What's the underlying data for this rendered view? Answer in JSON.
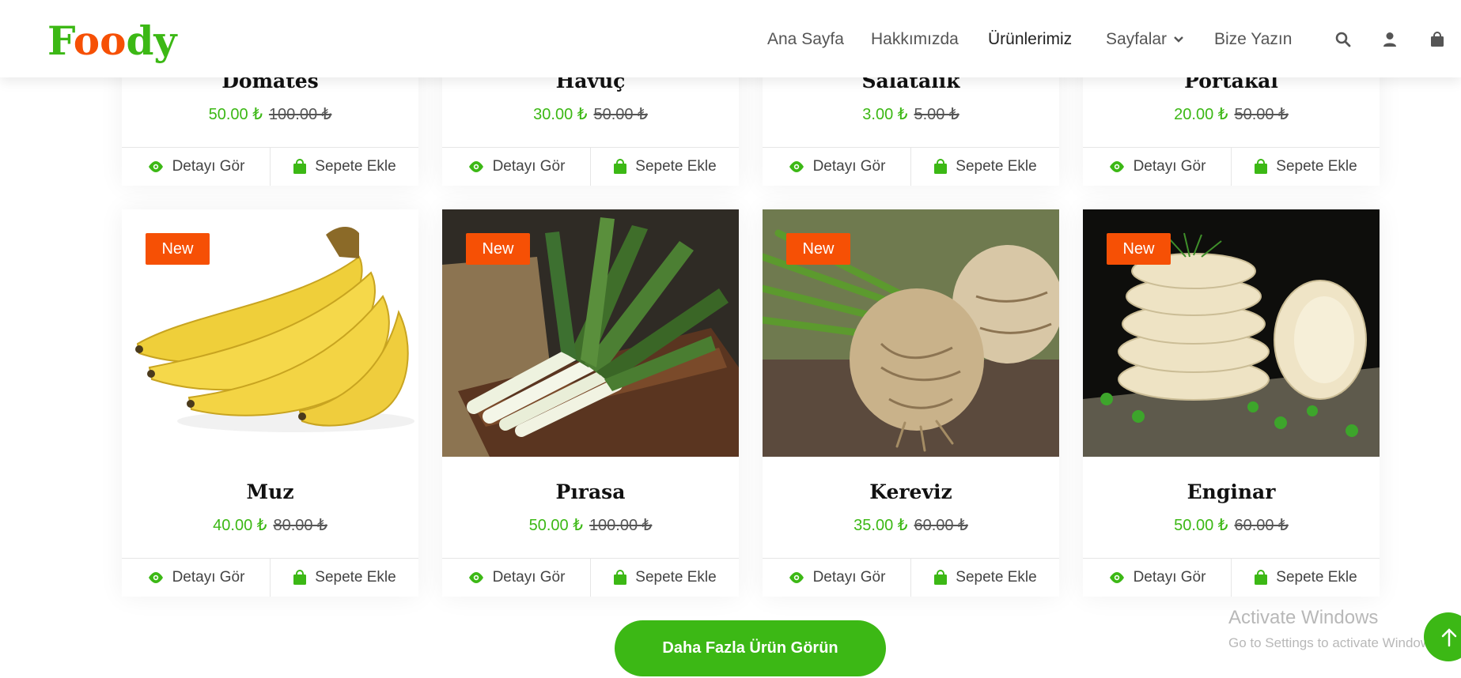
{
  "brand": {
    "part1": "F",
    "part2": "oo",
    "part3": "dy"
  },
  "nav": {
    "items": [
      "Ana Sayfa",
      "Hakkımızda",
      "Ürünlerimiz",
      "Sayfalar",
      "Bize Yazın"
    ],
    "active": "Ürünlerimiz",
    "icons": [
      "search-icon",
      "user-icon",
      "shopping-bag-icon"
    ]
  },
  "colors": {
    "green": "#3cb815",
    "orange": "#f65005"
  },
  "actions": {
    "detail": "Detayı Gör",
    "add_to_cart": "Sepete Ekle"
  },
  "products_top": [
    {
      "name": "Domates",
      "price": "50.00 ₺",
      "old_price": "100.00 ₺"
    },
    {
      "name": "Havuç",
      "price": "30.00 ₺",
      "old_price": "50.00 ₺"
    },
    {
      "name": "Salatalık",
      "price": "3.00 ₺",
      "old_price": "5.00 ₺"
    },
    {
      "name": "Portakal",
      "price": "20.00 ₺",
      "old_price": "50.00 ₺"
    }
  ],
  "products": [
    {
      "badge": "New",
      "name": "Muz",
      "price": "40.00 ₺",
      "old_price": "80.00 ₺",
      "image": "banana-image"
    },
    {
      "badge": "New",
      "name": "Pırasa",
      "price": "50.00 ₺",
      "old_price": "100.00 ₺",
      "image": "leek-image"
    },
    {
      "badge": "New",
      "name": "Kereviz",
      "price": "35.00 ₺",
      "old_price": "60.00 ₺",
      "image": "celeriac-image"
    },
    {
      "badge": "New",
      "name": "Enginar",
      "price": "50.00 ₺",
      "old_price": "60.00 ₺",
      "image": "artichoke-image"
    }
  ],
  "more_button": "Daha Fazla Ürün Görün",
  "watermark": {
    "line1": "Activate Windows",
    "line2": "Go to Settings to activate Windows."
  }
}
